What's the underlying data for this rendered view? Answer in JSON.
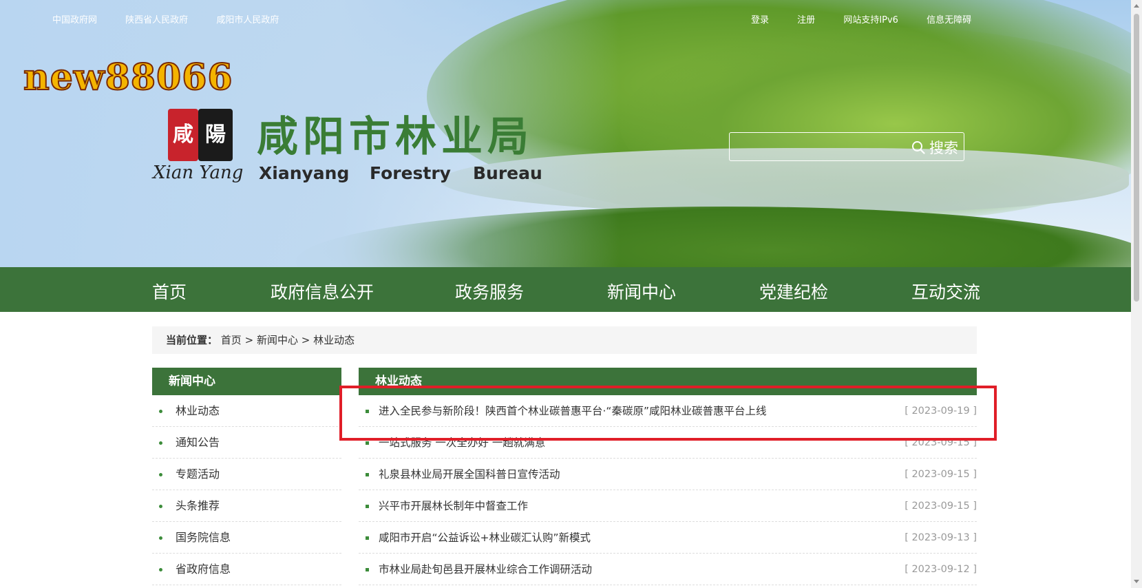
{
  "top_links_left": [
    "中国政府网",
    "陕西省人民政府",
    "咸阳市人民政府"
  ],
  "top_links_right": [
    "登录",
    "注册",
    "网站支持IPv6",
    "信息无障碍"
  ],
  "watermark": "new88066",
  "logo": {
    "seal_left": "咸",
    "seal_right": "陽",
    "caption": "Xian Yang"
  },
  "site_title": "咸阳市林业局",
  "site_title_en": [
    "Xianyang",
    "Forestry",
    "Bureau"
  ],
  "search": {
    "value": "",
    "button_label": "搜索"
  },
  "nav": [
    "首页",
    "政府信息公开",
    "政务服务",
    "新闻中心",
    "党建纪检",
    "互动交流"
  ],
  "breadcrumb": {
    "label": "当前位置：",
    "items": [
      "首页",
      "新闻中心",
      "林业动态"
    ],
    "separator": ">"
  },
  "sidebar": {
    "title": "新闻中心",
    "items": [
      "林业动态",
      "通知公告",
      "专题活动",
      "头条推荐",
      "国务院信息",
      "省政府信息"
    ]
  },
  "main": {
    "title": "林业动态",
    "news": [
      {
        "title": "进入全民参与新阶段！陕西首个林业碳普惠平台·“秦碳原”咸阳林业碳普惠平台上线",
        "date": "[ 2023-09-19 ]"
      },
      {
        "title": "一站式服务 一次全办好 一趟就满意",
        "date": "[ 2023-09-15 ]"
      },
      {
        "title": "礼泉县林业局开展全国科普日宣传活动",
        "date": "[ 2023-09-15 ]"
      },
      {
        "title": "兴平市开展林长制年中督查工作",
        "date": "[ 2023-09-15 ]"
      },
      {
        "title": "咸阳市开启“公益诉讼+林业碳汇认购”新模式",
        "date": "[ 2023-09-13 ]"
      },
      {
        "title": "市林业局赴旬邑县开展林业综合工作调研活动",
        "date": "[ 2023-09-12 ]"
      }
    ]
  },
  "colors": {
    "nav_green": "#3c733a",
    "title_green": "#3a7d35",
    "highlight_red": "#e01e28"
  }
}
